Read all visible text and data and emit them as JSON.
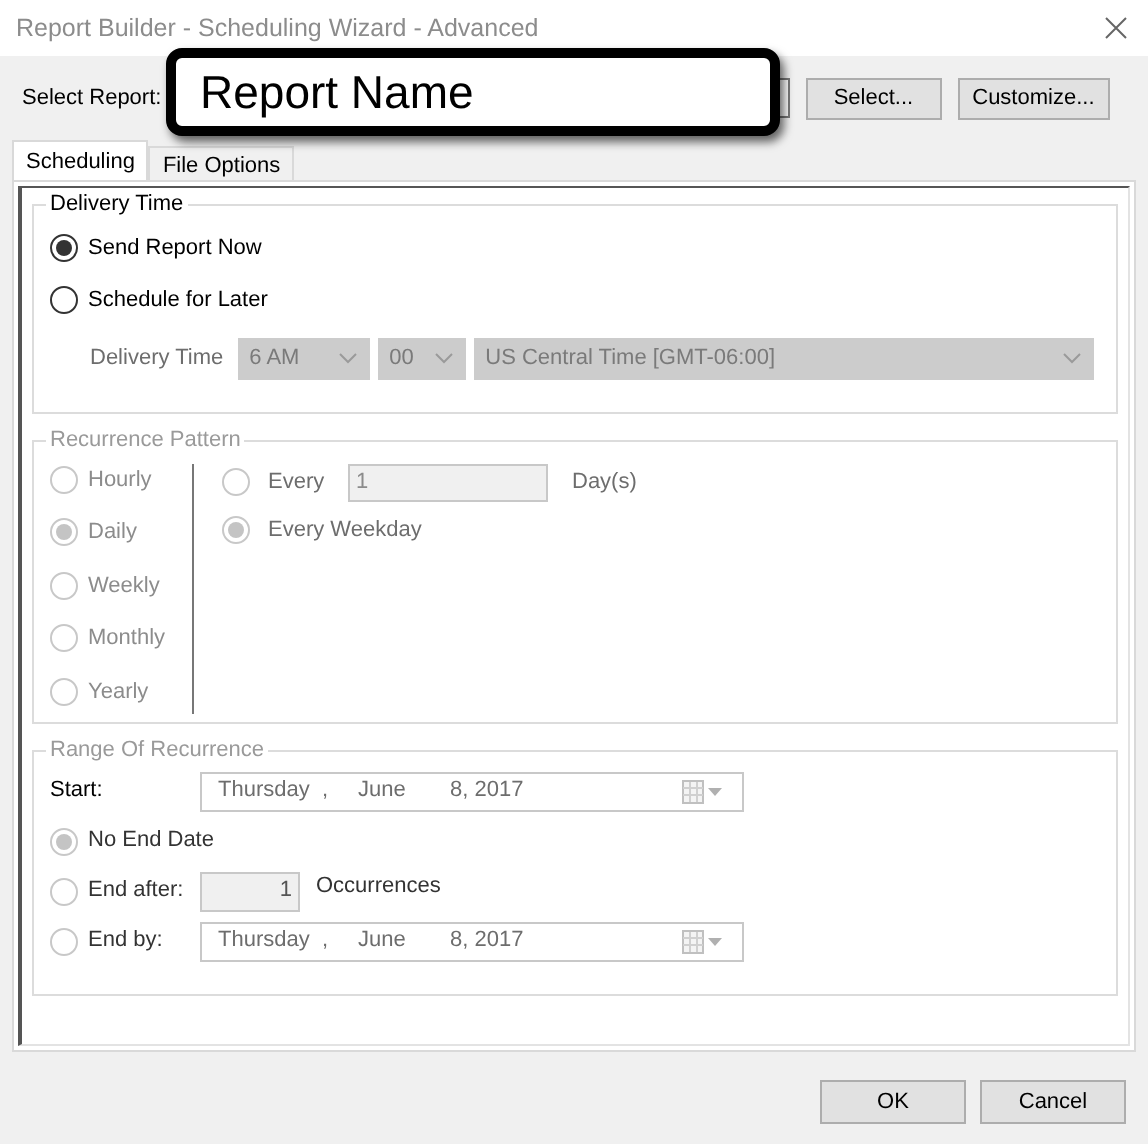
{
  "window": {
    "title": "Report Builder - Scheduling Wizard - Advanced"
  },
  "select_report": {
    "label": "Select Report:",
    "callout": "Report Name",
    "buttons": [
      "Select...",
      "Customize..."
    ]
  },
  "tabs": [
    {
      "label": "Scheduling",
      "selected": true
    },
    {
      "label": "File Options",
      "selected": false
    }
  ],
  "delivery_time": {
    "title": "Delivery Time",
    "disabled": false,
    "options": [
      {
        "label": "Send Report Now",
        "selected": true
      },
      {
        "label": "Schedule for Later",
        "selected": false
      }
    ],
    "time_label": "Delivery Time",
    "time_disabled": true,
    "hour": "6 AM",
    "minute": "00",
    "timezone": "US Central Time [GMT-06:00]"
  },
  "recurrence_pattern": {
    "title": "Recurrence Pattern",
    "disabled": true,
    "frequencies": [
      {
        "label": "Hourly",
        "selected": false
      },
      {
        "label": "Daily",
        "selected": true
      },
      {
        "label": "Weekly",
        "selected": false
      },
      {
        "label": "Monthly",
        "selected": false
      },
      {
        "label": "Yearly",
        "selected": false
      }
    ],
    "every_label": "Every",
    "every_value": "1",
    "every_unit": "Day(s)",
    "every_selected": false,
    "weekday_label": "Every Weekday",
    "weekday_selected": true
  },
  "range": {
    "title": "Range Of Recurrence",
    "disabled": true,
    "start_label": "Start:",
    "start_date": [
      "Thursday",
      ",",
      "June",
      "8, 2017"
    ],
    "end_options": [
      {
        "kind": "none",
        "label": "No End Date",
        "selected": true
      },
      {
        "kind": "after",
        "label": "End after:",
        "value": "1",
        "unit": "Occurrences",
        "selected": false
      },
      {
        "kind": "by",
        "label": "End by:",
        "date": [
          "Thursday",
          ",",
          "June",
          "8, 2017"
        ],
        "selected": false
      }
    ]
  },
  "footer_buttons": [
    "OK",
    "Cancel"
  ]
}
